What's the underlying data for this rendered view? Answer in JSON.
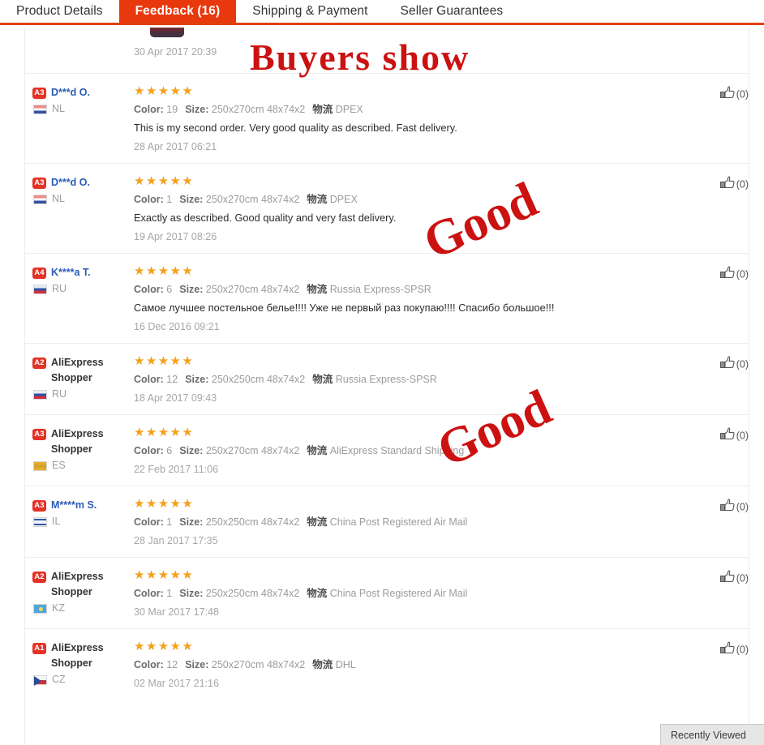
{
  "tabs": [
    {
      "label": "Product Details",
      "active": false
    },
    {
      "label": "Feedback (16)",
      "active": true
    },
    {
      "label": "Shipping & Payment",
      "active": false
    },
    {
      "label": "Seller Guarantees",
      "active": false
    }
  ],
  "labels": {
    "color": "Color:",
    "size": "Size:",
    "logistics_cn": "物流",
    "stars_full": "★★★★★"
  },
  "colors": {
    "accent_red": "#e8380d",
    "tab_underline": "#e0400f",
    "star_orange": "#f6a01a",
    "username_blue": "#2a5bb5",
    "badge_red": "#e43226",
    "watermark_red": "#cc1111",
    "muted_gray": "#9b9b9b"
  },
  "watermarks": {
    "buyers_show": "Buyers show",
    "good_1": "Good",
    "good_2": "Good"
  },
  "partial_top_row": {
    "date": "30 Apr 2017 20:39"
  },
  "reviews": [
    {
      "level": "A3",
      "name": "D***d O.",
      "anonymous": false,
      "country": "NL",
      "stars": "★★★★★",
      "color": "19",
      "size": "250x270cm 48x74x2",
      "logistics": "DPEX",
      "text": "This is my second order. Very good quality as described. Fast delivery.",
      "date": "28 Apr 2017 06:21",
      "helpful": "(0)"
    },
    {
      "level": "A3",
      "name": "D***d O.",
      "anonymous": false,
      "country": "NL",
      "stars": "★★★★★",
      "color": "1",
      "size": "250x270cm 48x74x2",
      "logistics": "DPEX",
      "text": "Exactly as described. Good quality and very fast delivery.",
      "date": "19 Apr 2017 08:26",
      "helpful": "(0)"
    },
    {
      "level": "A4",
      "name": "K****a T.",
      "anonymous": false,
      "country": "RU",
      "stars": "★★★★★",
      "color": "6",
      "size": "250x270cm 48x74x2",
      "logistics": "Russia Express-SPSR",
      "text": "Самое лучшее постельное белье!!!! Уже не первый раз покупаю!!!! Спасибо большое!!!",
      "date": "16 Dec 2016 09:21",
      "helpful": "(0)"
    },
    {
      "level": "A2",
      "name": "AliExpress Shopper",
      "anonymous": true,
      "country": "RU",
      "stars": "★★★★★",
      "color": "12",
      "size": "250x250cm 48x74x2",
      "logistics": "Russia Express-SPSR",
      "text": "",
      "date": "18 Apr 2017 09:43",
      "helpful": "(0)"
    },
    {
      "level": "A3",
      "name": "AliExpress Shopper",
      "anonymous": true,
      "country": "ES",
      "stars": "★★★★★",
      "color": "6",
      "size": "250x270cm 48x74x2",
      "logistics": "AliExpress Standard Shipping",
      "text": "",
      "date": "22 Feb 2017 11:06",
      "helpful": "(0)"
    },
    {
      "level": "A3",
      "name": "M****m S.",
      "anonymous": false,
      "country": "IL",
      "stars": "★★★★★",
      "color": "1",
      "size": "250x250cm 48x74x2",
      "logistics": "China Post Registered Air Mail",
      "text": "",
      "date": "28 Jan 2017 17:35",
      "helpful": "(0)"
    },
    {
      "level": "A2",
      "name": "AliExpress Shopper",
      "anonymous": true,
      "country": "KZ",
      "stars": "★★★★★",
      "color": "1",
      "size": "250x250cm 48x74x2",
      "logistics": "China Post Registered Air Mail",
      "text": "",
      "date": "30 Mar 2017 17:48",
      "helpful": "(0)"
    },
    {
      "level": "A1",
      "name": "AliExpress Shopper",
      "anonymous": true,
      "country": "CZ",
      "stars": "★★★★★",
      "color": "12",
      "size": "250x270cm 48x74x2",
      "logistics": "DHL",
      "text": "",
      "date": "02 Mar 2017 21:16",
      "helpful": "(0)"
    }
  ],
  "recently_viewed": {
    "label": "Recently Viewed"
  }
}
